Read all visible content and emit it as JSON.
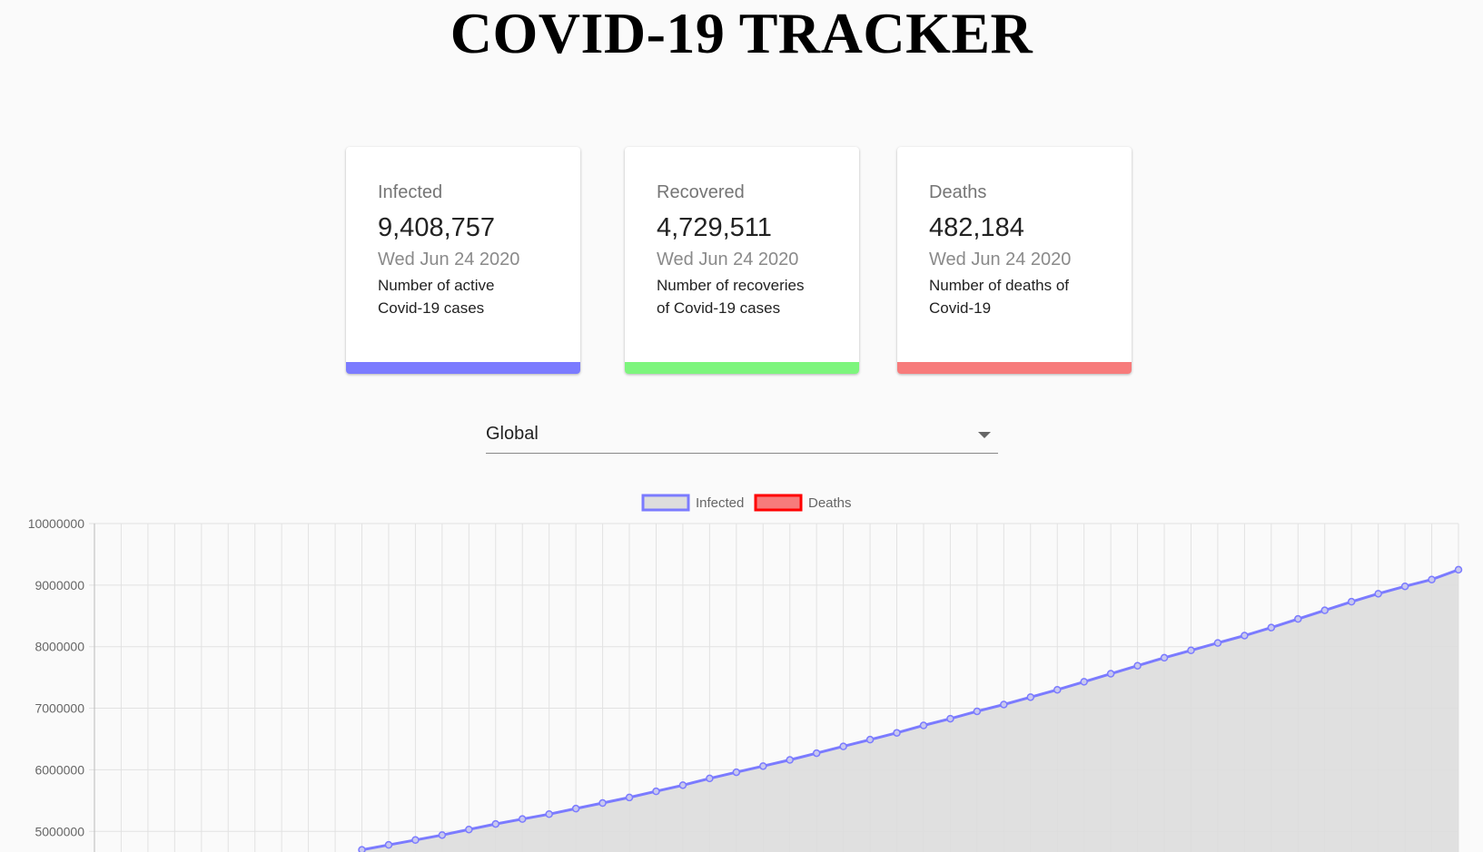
{
  "app": {
    "title": "COVID-19 TRACKER"
  },
  "cards": [
    {
      "label": "Infected",
      "value": "9,408,757",
      "date": "Wed Jun 24 2020",
      "description": "Number of active Covid-19 cases",
      "color": "#7b7bff"
    },
    {
      "label": "Recovered",
      "value": "4,729,511",
      "date": "Wed Jun 24 2020",
      "description": "Number of recoveries of Covid-19 cases",
      "color": "#7df57d"
    },
    {
      "label": "Deaths",
      "value": "482,184",
      "date": "Wed Jun 24 2020",
      "description": "Number of deaths of Covid-19",
      "color": "#f77b7b"
    }
  ],
  "country_picker": {
    "selected": "Global"
  },
  "chart_data": {
    "type": "line",
    "title": "",
    "xlabel": "",
    "ylabel": "",
    "ylim": [
      4650000,
      10000000
    ],
    "grid": true,
    "legend_position": "top-center",
    "y_ticks": [
      "10000000",
      "9000000",
      "8000000",
      "7000000",
      "6000000",
      "5000000"
    ],
    "series": [
      {
        "name": "Infected",
        "color": "#7b7bff",
        "fill": "#dddddd",
        "values": [
          4700000,
          4780000,
          4860000,
          4940000,
          5030000,
          5120000,
          5200000,
          5280000,
          5370000,
          5460000,
          5550000,
          5650000,
          5750000,
          5860000,
          5960000,
          6060000,
          6160000,
          6270000,
          6380000,
          6490000,
          6600000,
          6720000,
          6830000,
          6950000,
          7060000,
          7180000,
          7300000,
          7430000,
          7560000,
          7690000,
          7820000,
          7940000,
          8060000,
          8180000,
          8310000,
          8450000,
          8590000,
          8730000,
          8860000,
          8980000,
          9090000,
          9250000
        ]
      },
      {
        "name": "Deaths",
        "color": "#ff0000",
        "fill": "#f77b7b",
        "values": []
      }
    ]
  }
}
